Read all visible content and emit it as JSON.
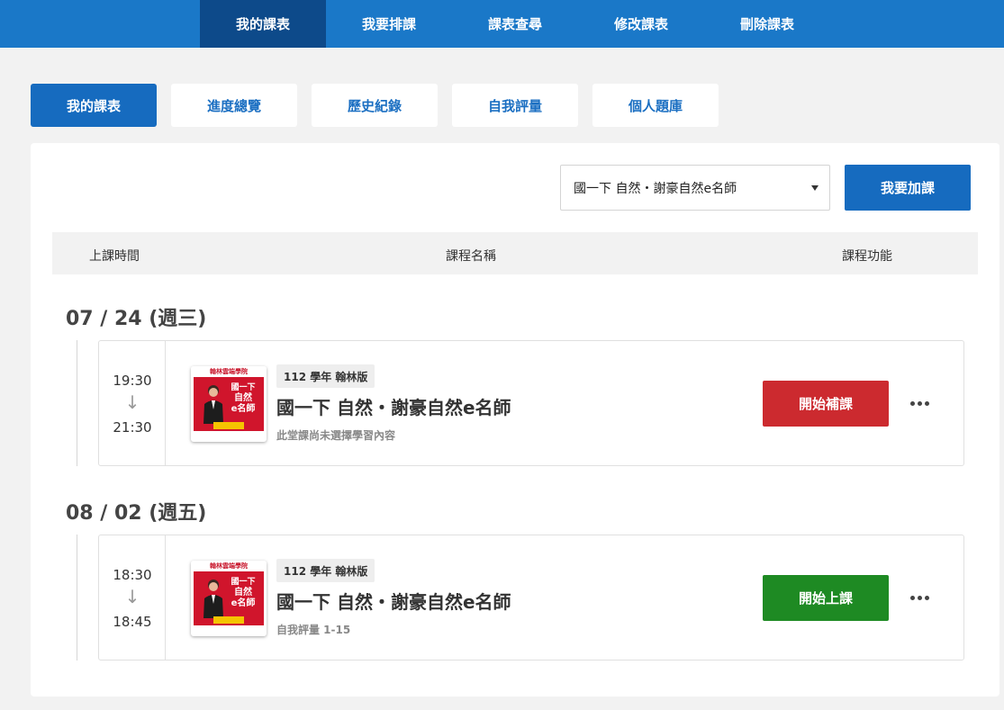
{
  "topnav": {
    "items": [
      {
        "label": "我的課表",
        "active": true
      },
      {
        "label": "我要排課",
        "active": false
      },
      {
        "label": "課表查尋",
        "active": false
      },
      {
        "label": "修改課表",
        "active": false
      },
      {
        "label": "刪除課表",
        "active": false
      }
    ]
  },
  "subtabs": [
    {
      "label": "我的課表",
      "active": true
    },
    {
      "label": "進度總覽",
      "active": false
    },
    {
      "label": "歷史紀錄",
      "active": false
    },
    {
      "label": "自我評量",
      "active": false
    },
    {
      "label": "個人題庫",
      "active": false
    }
  ],
  "course_select": {
    "value": "國一下 自然・謝豪自然e名師"
  },
  "add_button": {
    "label": "我要加課"
  },
  "table_header": {
    "time": "上課時間",
    "name": "課程名稱",
    "function": "課程功能"
  },
  "thumbnail": {
    "brand": "翰林雲端學院",
    "title_line1": "國一下",
    "title_line2": "自然",
    "title_line3": "e名師"
  },
  "days": [
    {
      "date": "07 / 24 (週三)",
      "session": {
        "start": "19:30",
        "arrow": "↓",
        "end": "21:30",
        "badge": "112 學年 翰林版",
        "title": "國一下 自然・謝豪自然e名師",
        "subtitle": "此堂課尚未選擇學習內容",
        "action_label": "開始補課",
        "action_color": "#cc2a2f"
      }
    },
    {
      "date": "08 / 02 (週五)",
      "session": {
        "start": "18:30",
        "arrow": "↓",
        "end": "18:45",
        "badge": "112 學年 翰林版",
        "title": "國一下 自然・謝豪自然e名師",
        "subtitle": "自我評量 1-15",
        "action_label": "開始上課",
        "action_color": "#1e8a23"
      }
    }
  ]
}
